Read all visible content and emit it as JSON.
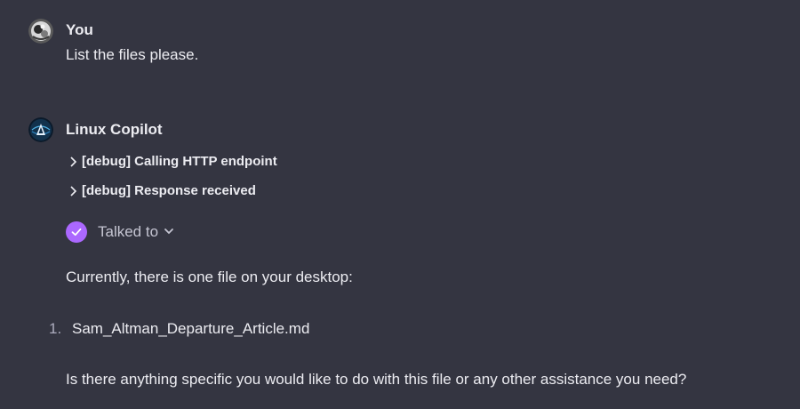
{
  "user_message": {
    "author": "You",
    "text": "List the files please."
  },
  "assistant_message": {
    "author": "Linux Copilot",
    "debug_lines": [
      "[debug] Calling HTTP endpoint",
      "[debug] Response received"
    ],
    "plugin_status": "Talked to",
    "intro": "Currently, there is one file on your desktop:",
    "list": [
      {
        "number": "1.",
        "text": "Sam_Altman_Departure_Article.md"
      }
    ],
    "closing": "Is there anything specific you would like to do with this file or any other assistance you need?"
  },
  "colors": {
    "background": "#343541",
    "text": "#ececf1",
    "accent": "#ab68ff"
  },
  "icons": [
    "user-avatar",
    "copilot-avatar",
    "chevron-right-icon",
    "check-icon",
    "chevron-down-icon"
  ]
}
